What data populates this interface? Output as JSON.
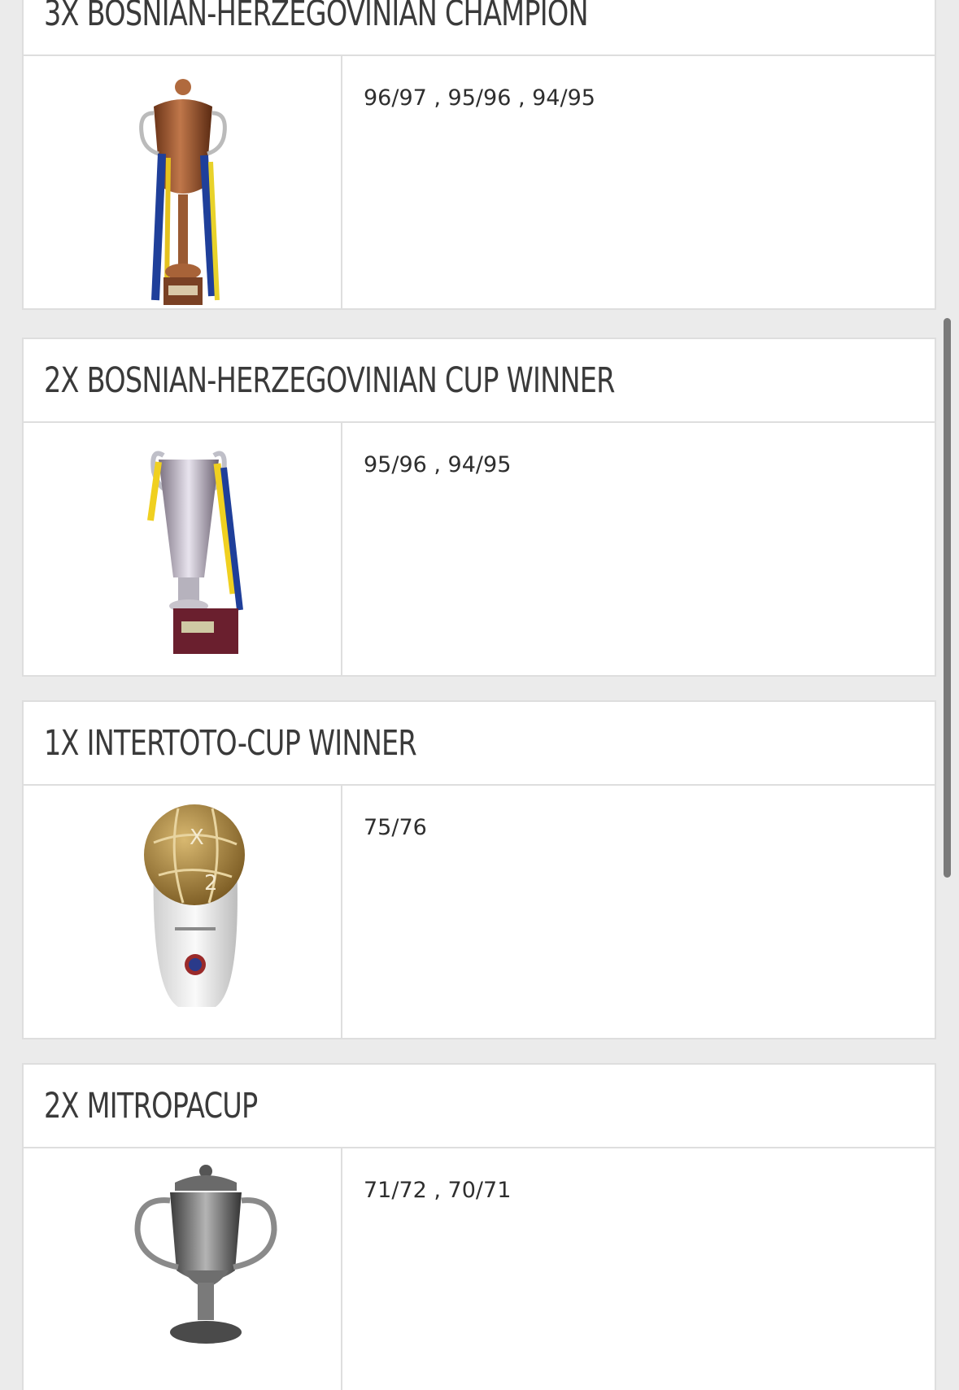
{
  "honours": [
    {
      "title": "3X BOSNIAN-HERZEGOVINIAN CHAMPION",
      "seasons": "96/97 , 95/96 , 94/95",
      "trophy_icon": "bronze-cup-with-ribbons-icon"
    },
    {
      "title": "2X BOSNIAN-HERZEGOVINIAN CUP WINNER",
      "seasons": "95/96 , 94/95",
      "trophy_icon": "silver-cup-with-ribbons-icon"
    },
    {
      "title": "1X INTERTOTO-CUP WINNER",
      "seasons": "75/76",
      "trophy_icon": "intertoto-ball-trophy-icon"
    },
    {
      "title": "2X MITROPACUP",
      "seasons": "71/72 , 70/71",
      "trophy_icon": "silver-urn-cup-icon"
    }
  ],
  "colors": {
    "page_background": "#ebebeb",
    "card_background": "#ffffff",
    "border": "#dedede",
    "title_text": "#3a3a3a",
    "body_text": "#2e2e2e",
    "scrollbar": "#7a7a7a"
  }
}
